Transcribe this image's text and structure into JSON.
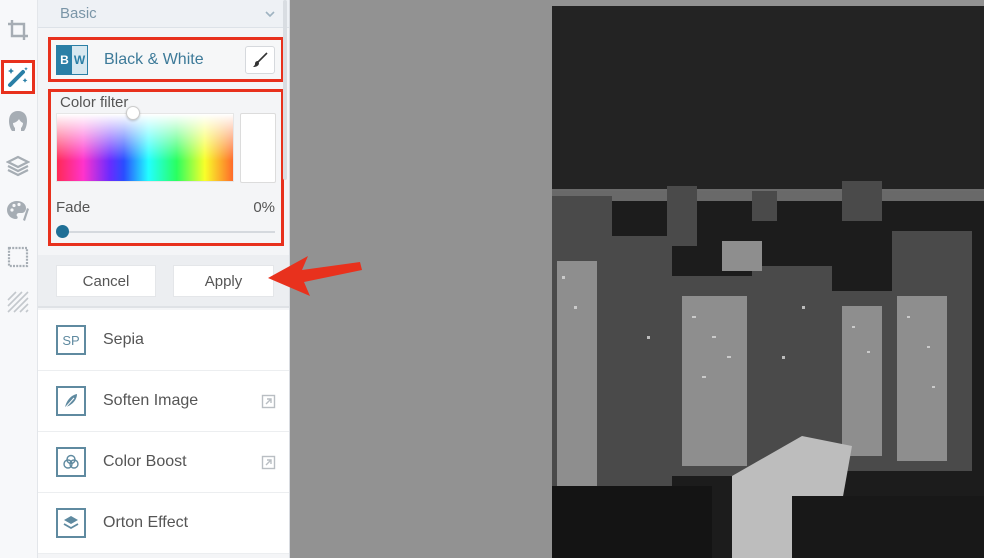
{
  "tool_rail": {
    "items": [
      {
        "name": "crop",
        "icon": "crop-icon",
        "active": false
      },
      {
        "name": "effects",
        "icon": "magic-wand-icon",
        "active": true
      },
      {
        "name": "touch-up",
        "icon": "face-icon",
        "active": false
      },
      {
        "name": "layers",
        "icon": "layers-icon",
        "active": false
      },
      {
        "name": "paint",
        "icon": "palette-icon",
        "active": false
      },
      {
        "name": "frames",
        "icon": "frame-icon",
        "active": false
      },
      {
        "name": "textures",
        "icon": "texture-icon",
        "active": false
      }
    ]
  },
  "panel": {
    "section_title": "Basic",
    "active_effect": {
      "badge_left": "B",
      "badge_right": "W",
      "label": "Black & White",
      "brush_icon": "brush-icon"
    },
    "color_filter": {
      "label": "Color filter",
      "selected_color": "#ffffff"
    },
    "fade": {
      "label": "Fade",
      "value_text": "0%",
      "value": 0
    },
    "buttons": {
      "cancel": "Cancel",
      "apply": "Apply"
    },
    "effects": [
      {
        "label": "Sepia",
        "icon": "SP",
        "premium": false
      },
      {
        "label": "Soften Image",
        "icon": "feather-icon",
        "premium": true
      },
      {
        "label": "Color Boost",
        "icon": "color-boost-icon",
        "premium": true
      },
      {
        "label": "Orton Effect",
        "icon": "orton-icon",
        "premium": false
      }
    ]
  },
  "colors": {
    "accent": "#2a7fa6",
    "highlight": "#e8311d",
    "canvas_bg": "#929292"
  }
}
